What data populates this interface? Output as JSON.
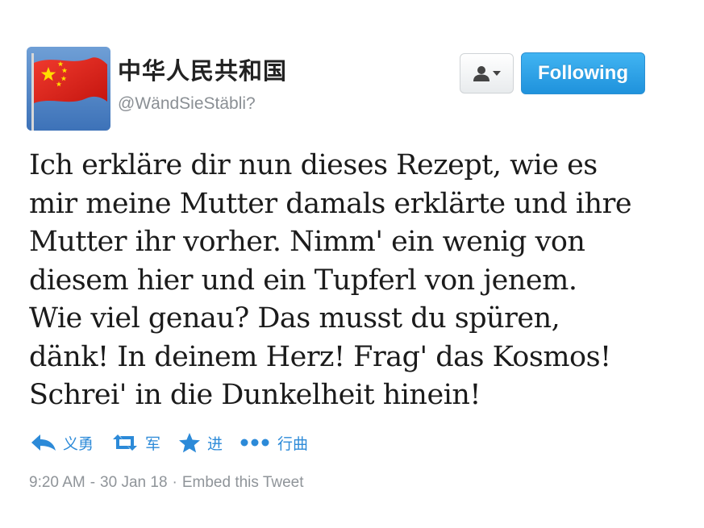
{
  "user": {
    "display_name": "中华人民共和国",
    "handle": "@WändSieStäbli?"
  },
  "header": {
    "follow_state_label": "Following"
  },
  "tweet": {
    "lines": [
      "Ich erkläre dir nun dieses Rezept, wie es",
      "mir meine Mutter damals erklärte und ihre",
      "Mutter ihr vorher. Nimm' ein wenig von",
      "diesem hier und ein Tupferl von jenem.",
      "Wie viel genau? Das musst du spüren,",
      "dänk! In deinem Herz! Frag' das Kosmos!",
      "Schrei' in die Dunkelheit hinein!"
    ]
  },
  "actions": {
    "reply_label": "义勇",
    "retweet_label": "军",
    "favorite_label": "进",
    "more_label": "行曲"
  },
  "meta": {
    "time": "9:20 AM",
    "separator": "-",
    "date": "30 Jan 18",
    "dot": "·",
    "embed_label": "Embed this Tweet"
  },
  "colors": {
    "accent_blue": "#2c8ad8",
    "following_button": "#2a9ae4",
    "flag_red": "#d81e1e",
    "flag_star": "#ffde00"
  },
  "icons": {
    "avatar": "china-flag-icon",
    "user_menu": "user-icon",
    "reply": "reply-icon",
    "retweet": "retweet-icon",
    "favorite": "star-icon",
    "more": "more-dots-icon"
  }
}
